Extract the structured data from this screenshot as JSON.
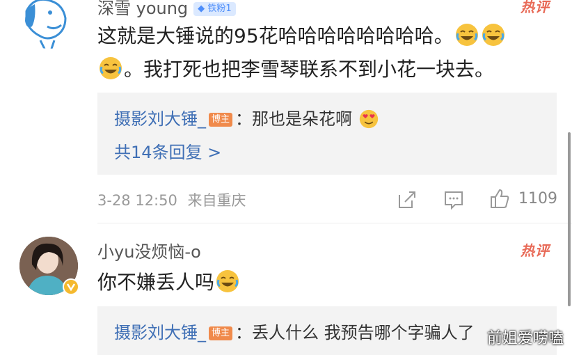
{
  "comment1": {
    "username": "深雪 young",
    "fan_badge": "铁粉1",
    "hot_tag": "热评",
    "text_part1": "这就是大锤说的95花哈哈哈哈哈哈哈哈。",
    "text_part2": "。我打死也把李雪琴联系不到小花一块去。",
    "reply": {
      "user": "摄影刘大锤_",
      "badge": "博主",
      "text": "：那也是朵花啊",
      "more": "共14条回复 >"
    },
    "date": "3-28 12:50",
    "location": "来自重庆",
    "likes": "1109"
  },
  "comment2": {
    "username": "小yu没烦恼-o",
    "hot_tag": "热评",
    "text": "你不嫌丢人吗",
    "reply": {
      "user": "摄影刘大锤_",
      "badge": "博主",
      "text": "：丢人什么 我预告哪个字骗人了"
    }
  },
  "watermark": "前姐爱唠嗑",
  "colors": {
    "link_blue": "#3f6fb5",
    "hot_red": "#e86a57",
    "reply_bg": "#f3f3f3"
  }
}
